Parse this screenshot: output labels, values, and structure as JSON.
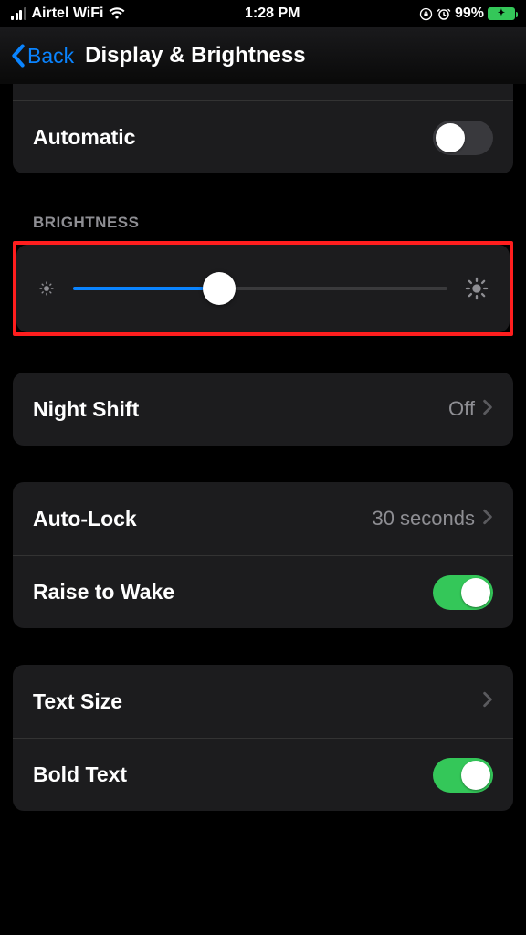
{
  "statusbar": {
    "carrier": "Airtel WiFi",
    "time": "1:28 PM",
    "battery_pct": "99%"
  },
  "nav": {
    "back_label": "Back",
    "title": "Display & Brightness"
  },
  "automatic": {
    "label": "Automatic",
    "on": false
  },
  "brightness": {
    "header": "BRIGHTNESS",
    "value_pct": 39
  },
  "night_shift": {
    "label": "Night Shift",
    "value": "Off"
  },
  "auto_lock": {
    "label": "Auto-Lock",
    "value": "30 seconds"
  },
  "raise_to_wake": {
    "label": "Raise to Wake",
    "on": true
  },
  "text_size": {
    "label": "Text Size"
  },
  "bold_text": {
    "label": "Bold Text",
    "on": true
  }
}
